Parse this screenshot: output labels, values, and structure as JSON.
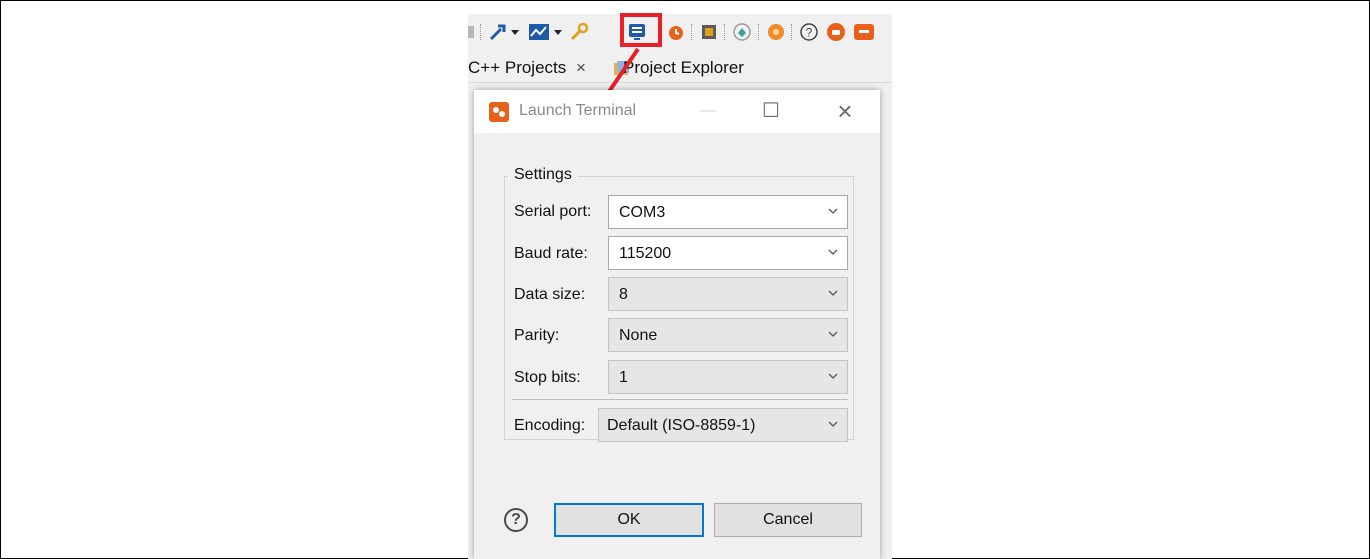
{
  "tabs": {
    "cpp_projects": "C++ Projects",
    "close_glyph": "×",
    "project_explorer": "Project Explorer"
  },
  "dialog": {
    "title": "Launch Terminal",
    "minimize": "—",
    "maximize": "☐",
    "close": "×",
    "settings_label": "Settings",
    "fields": {
      "serial_port": {
        "label": "Serial port:",
        "value": "COM3"
      },
      "baud_rate": {
        "label": "Baud rate:",
        "value": "115200"
      },
      "data_size": {
        "label": "Data size:",
        "value": "8"
      },
      "parity": {
        "label": "Parity:",
        "value": "None"
      },
      "stop_bits": {
        "label": "Stop bits:",
        "value": "1"
      },
      "encoding": {
        "label": "Encoding:",
        "value": "Default (ISO-8859-1)"
      }
    },
    "help_glyph": "?",
    "ok_label": "OK",
    "cancel_label": "Cancel"
  },
  "colors": {
    "highlight": "#e8202a",
    "accent": "#0078d7",
    "app_icon": "#e8611a"
  },
  "icons": [
    "build-hammer-icon",
    "dropdown-arrow-icon",
    "chart-icon",
    "dropdown-arrow-icon",
    "wrench-icon",
    "terminal-icon",
    "timer-icon",
    "chip-icon",
    "gem-icon",
    "gear-icon",
    "help-icon",
    "bug-icon",
    "chat-icon"
  ]
}
